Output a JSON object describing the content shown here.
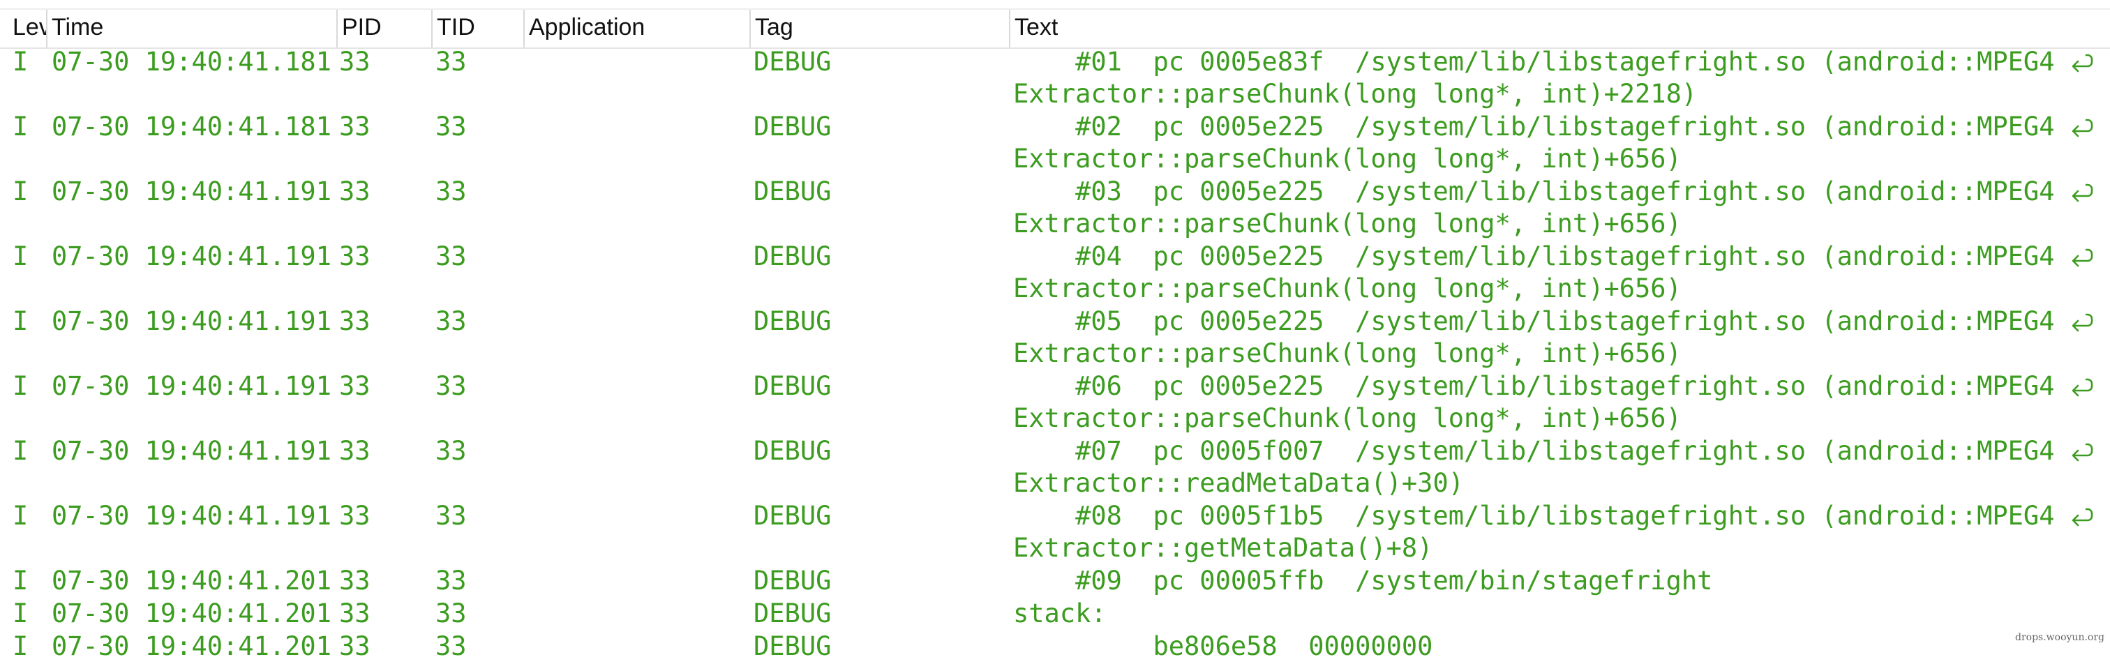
{
  "columns": [
    "Level",
    "Time",
    "PID",
    "TID",
    "Application",
    "Tag",
    "Text"
  ],
  "rows": [
    {
      "level": "I",
      "time": "07-30 19:40:41.181",
      "pid": "33",
      "tid": "33",
      "app": "",
      "tag": "DEBUG",
      "text": [
        "    #01  pc 0005e83f  /system/lib/libstagefright.so (android::MPEG4",
        "Extractor::parseChunk(long long*, int)+2218)"
      ],
      "wrapped": true
    },
    {
      "level": "I",
      "time": "07-30 19:40:41.181",
      "pid": "33",
      "tid": "33",
      "app": "",
      "tag": "DEBUG",
      "text": [
        "    #02  pc 0005e225  /system/lib/libstagefright.so (android::MPEG4",
        "Extractor::parseChunk(long long*, int)+656)"
      ],
      "wrapped": true
    },
    {
      "level": "I",
      "time": "07-30 19:40:41.191",
      "pid": "33",
      "tid": "33",
      "app": "",
      "tag": "DEBUG",
      "text": [
        "    #03  pc 0005e225  /system/lib/libstagefright.so (android::MPEG4",
        "Extractor::parseChunk(long long*, int)+656)"
      ],
      "wrapped": true
    },
    {
      "level": "I",
      "time": "07-30 19:40:41.191",
      "pid": "33",
      "tid": "33",
      "app": "",
      "tag": "DEBUG",
      "text": [
        "    #04  pc 0005e225  /system/lib/libstagefright.so (android::MPEG4",
        "Extractor::parseChunk(long long*, int)+656)"
      ],
      "wrapped": true
    },
    {
      "level": "I",
      "time": "07-30 19:40:41.191",
      "pid": "33",
      "tid": "33",
      "app": "",
      "tag": "DEBUG",
      "text": [
        "    #05  pc 0005e225  /system/lib/libstagefright.so (android::MPEG4",
        "Extractor::parseChunk(long long*, int)+656)"
      ],
      "wrapped": true
    },
    {
      "level": "I",
      "time": "07-30 19:40:41.191",
      "pid": "33",
      "tid": "33",
      "app": "",
      "tag": "DEBUG",
      "text": [
        "    #06  pc 0005e225  /system/lib/libstagefright.so (android::MPEG4",
        "Extractor::parseChunk(long long*, int)+656)"
      ],
      "wrapped": true
    },
    {
      "level": "I",
      "time": "07-30 19:40:41.191",
      "pid": "33",
      "tid": "33",
      "app": "",
      "tag": "DEBUG",
      "text": [
        "    #07  pc 0005f007  /system/lib/libstagefright.so (android::MPEG4",
        "Extractor::readMetaData()+30)"
      ],
      "wrapped": true
    },
    {
      "level": "I",
      "time": "07-30 19:40:41.191",
      "pid": "33",
      "tid": "33",
      "app": "",
      "tag": "DEBUG",
      "text": [
        "    #08  pc 0005f1b5  /system/lib/libstagefright.so (android::MPEG4",
        "Extractor::getMetaData()+8)"
      ],
      "wrapped": true
    },
    {
      "level": "I",
      "time": "07-30 19:40:41.201",
      "pid": "33",
      "tid": "33",
      "app": "",
      "tag": "DEBUG",
      "text": [
        "    #09  pc 00005ffb  /system/bin/stagefright"
      ],
      "wrapped": false
    },
    {
      "level": "I",
      "time": "07-30 19:40:41.201",
      "pid": "33",
      "tid": "33",
      "app": "",
      "tag": "DEBUG",
      "text": [
        "stack:"
      ],
      "wrapped": false
    },
    {
      "level": "I",
      "time": "07-30 19:40:41.201",
      "pid": "33",
      "tid": "33",
      "app": "",
      "tag": "DEBUG",
      "text": [
        "         be806e58  00000000"
      ],
      "wrapped": false
    }
  ],
  "icons": {
    "wrap": "line-wrap-icon"
  },
  "colors": {
    "log_text": "#3c9c20",
    "header_text": "#111111"
  },
  "watermark": "drops.wooyun.org"
}
